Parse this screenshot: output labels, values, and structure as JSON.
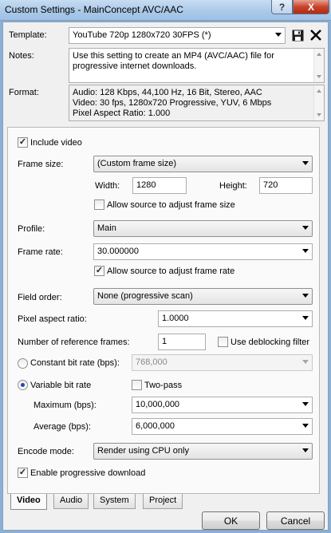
{
  "window": {
    "title": "Custom Settings - MainConcept AVC/AAC",
    "help_glyph": "?",
    "close_glyph": "X"
  },
  "template": {
    "label": "Template:",
    "value": "YouTube 720p 1280x720 30FPS (*)"
  },
  "notes": {
    "label": "Notes:",
    "value": "Use this setting to create an MP4 (AVC/AAC) file for progressive internet downloads."
  },
  "format": {
    "label": "Format:",
    "lines": [
      "Audio: 128 Kbps, 44,100 Hz, 16 Bit, Stereo, AAC",
      "Video: 30 fps, 1280x720 Progressive, YUV, 6 Mbps",
      "Pixel Aspect Ratio: 1.000"
    ]
  },
  "video": {
    "include_video": {
      "label": "Include video",
      "checked": true
    },
    "frame_size": {
      "label": "Frame size:",
      "value": "(Custom frame size)"
    },
    "width": {
      "label": "Width:",
      "value": "1280"
    },
    "height": {
      "label": "Height:",
      "value": "720"
    },
    "allow_frame_size": {
      "label": "Allow source to adjust frame size",
      "checked": false
    },
    "profile": {
      "label": "Profile:",
      "value": "Main"
    },
    "frame_rate": {
      "label": "Frame rate:",
      "value": "30.000000"
    },
    "allow_frame_rate": {
      "label": "Allow source to adjust frame rate",
      "checked": true
    },
    "field_order": {
      "label": "Field order:",
      "value": "None (progressive scan)"
    },
    "pixel_aspect": {
      "label": "Pixel aspect ratio:",
      "value": "1.0000"
    },
    "ref_frames": {
      "label": "Number of reference frames:",
      "value": "1"
    },
    "deblocking": {
      "label": "Use deblocking filter",
      "checked": false
    },
    "cbr": {
      "label": "Constant bit rate (bps):",
      "value": "768,000",
      "selected": false
    },
    "vbr": {
      "label": "Variable bit rate",
      "selected": true
    },
    "two_pass": {
      "label": "Two-pass",
      "checked": false
    },
    "maximum": {
      "label": "Maximum (bps):",
      "value": "10,000,000"
    },
    "average": {
      "label": "Average (bps):",
      "value": "6,000,000"
    },
    "encode_mode": {
      "label": "Encode mode:",
      "value": "Render using CPU only"
    },
    "progressive": {
      "label": "Enable progressive download",
      "checked": true
    }
  },
  "tabs": [
    "Video",
    "Audio",
    "System",
    "Project"
  ],
  "buttons": {
    "ok": "OK",
    "cancel": "Cancel"
  },
  "colors": {
    "accent": "#1a4fa8",
    "title_bar": "#a9c8e8",
    "close": "#c7442c"
  }
}
